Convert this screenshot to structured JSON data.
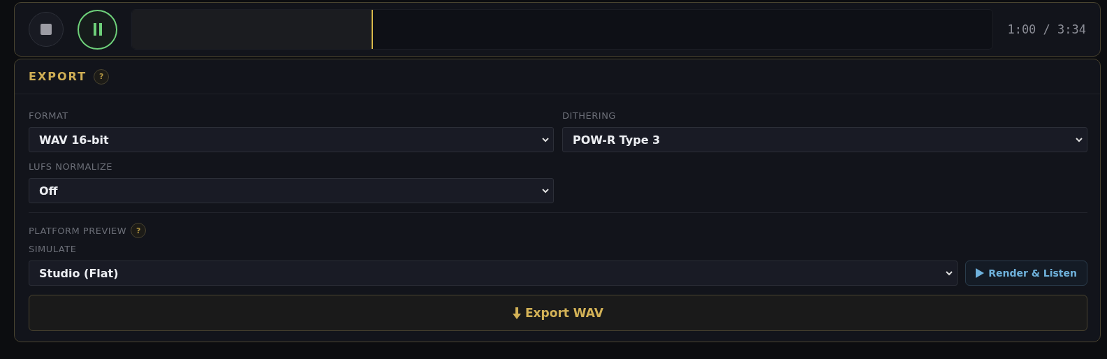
{
  "transport": {
    "playing": true,
    "progress": {
      "level": 0.28
    },
    "time": "1:00 / 3:34"
  },
  "export": {
    "title": "EXPORT",
    "help": "?",
    "fields": [
      {
        "label": "FORMAT",
        "value": "WAV 16-bit"
      },
      {
        "label": "DITHERING",
        "value": "POW-R Type 3"
      },
      {
        "label": "LUFS NORMALIZE",
        "value": "Off"
      }
    ],
    "platform_preview": {
      "title": "PLATFORM PREVIEW",
      "help": "?",
      "simulate_label": "SIMULATE",
      "simulate_value": "Studio (Flat)",
      "render_button": "Render & Listen"
    },
    "export_button": "Export WAV"
  }
}
